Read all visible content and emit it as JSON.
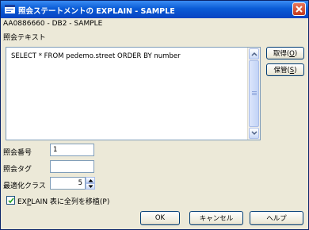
{
  "window": {
    "title": "照会ステートメントの EXPLAIN - SAMPLE"
  },
  "header": {
    "path": "AA0886660 - DB2 - SAMPLE"
  },
  "query": {
    "label": "照会テキスト",
    "text": "SELECT * FROM pedemo.street ORDER BY number"
  },
  "side_buttons": {
    "get": {
      "label": "取得",
      "mnemonic": "O"
    },
    "save": {
      "label": "保管",
      "mnemonic": "S"
    }
  },
  "fields": {
    "query_number": {
      "label": "照会番号",
      "value": "1"
    },
    "query_tag": {
      "label": "照会タグ",
      "value": ""
    },
    "opt_class": {
      "label": "最適化クラス",
      "value": "5"
    }
  },
  "checkbox": {
    "prefix": "EX",
    "mnemonic": "P",
    "suffix": "LAIN 表に全列を移植(P)",
    "checked": true
  },
  "buttons": {
    "ok": "OK",
    "cancel": "キャンセル",
    "help": "ヘルプ"
  },
  "colors": {
    "title_bar": "#0a5bd6",
    "dialog_bg": "#ece9d8",
    "field_border": "#7f9db9"
  }
}
